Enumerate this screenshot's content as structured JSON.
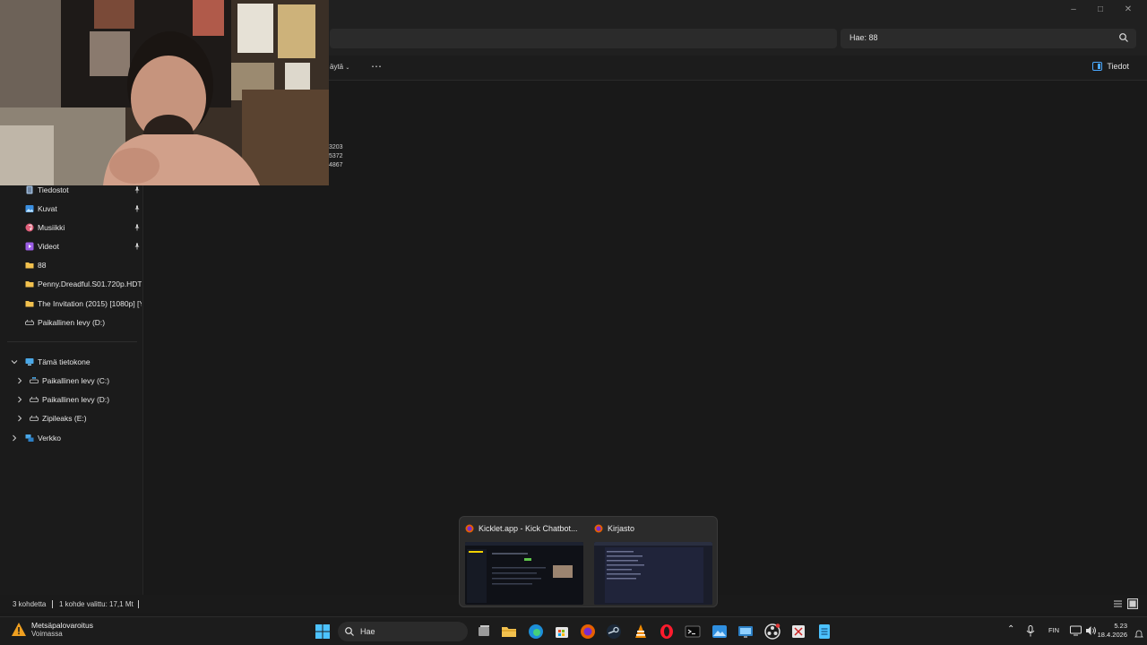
{
  "window": {
    "search_text": "Hae: 88",
    "cmd_view_label": "äytä",
    "details_label": "Tiedot"
  },
  "overlay_numbers": [
    "3203",
    "5372",
    "4867"
  ],
  "sidebar": {
    "quick": [
      {
        "label": "Tiedostot",
        "icon": "document-icon"
      },
      {
        "label": "Kuvat",
        "icon": "pictures-icon"
      },
      {
        "label": "Musiikki",
        "icon": "music-icon"
      },
      {
        "label": "Videot",
        "icon": "videos-icon"
      },
      {
        "label": "88",
        "icon": "folder-icon"
      },
      {
        "label": "Penny.Dreadful.S01.720p.HDTV.x2",
        "icon": "folder-icon"
      },
      {
        "label": "The Invitation (2015) [1080p] [YTS",
        "icon": "folder-icon"
      },
      {
        "label": "Paikallinen levy (D:)",
        "icon": "drive-icon"
      }
    ],
    "this_pc": "Tämä tietokone",
    "drives": [
      {
        "label": "Paikallinen levy (C:)",
        "icon": "windows-drive-icon"
      },
      {
        "label": "Paikallinen levy (D:)",
        "icon": "drive-icon"
      },
      {
        "label": "Zipileaks (E:)",
        "icon": "drive-icon"
      }
    ],
    "network": "Verkko"
  },
  "status": {
    "items": "3 kohdetta",
    "selected": "1 kohde valittu: 17,1 Mt"
  },
  "thumbnails": [
    {
      "title": "Kicklet.app - Kick Chatbot...",
      "icon": "firefox-icon"
    },
    {
      "title": "Kirjasto",
      "icon": "firefox-icon"
    }
  ],
  "taskbar": {
    "weather_title": "Metsäpalovaroitus",
    "weather_sub": "Voimassa",
    "search_placeholder": "Hae",
    "lang": "FIN",
    "time": "5.23",
    "date": "18.4.2026"
  }
}
